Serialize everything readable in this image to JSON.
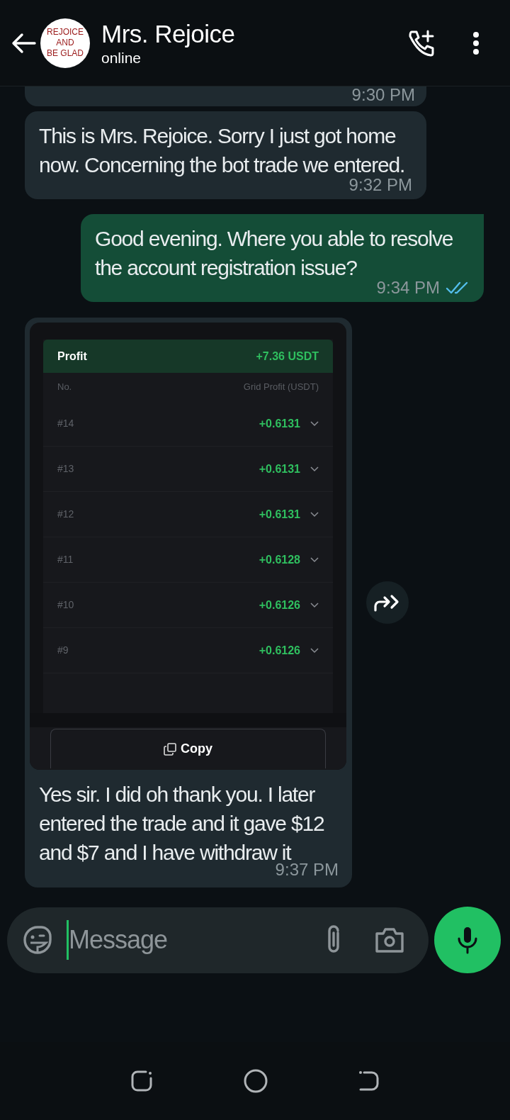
{
  "header": {
    "name": "Mrs. Rejoice",
    "status": "online",
    "avatar_lines": [
      "REJOICE",
      "AND",
      "BE GLAD"
    ]
  },
  "messages": [
    {
      "kind": "cut",
      "outgoing": false,
      "time": "9:30 PM"
    },
    {
      "kind": "text",
      "outgoing": false,
      "text": "This is Mrs. Rejoice. Sorry I just got home now. Concerning the bot trade we entered.",
      "time": "9:32 PM"
    },
    {
      "kind": "text",
      "outgoing": true,
      "text": "Good evening. Where you able to resolve the account registration issue?",
      "time": "9:34 PM",
      "read": true
    },
    {
      "kind": "image",
      "outgoing": false,
      "screenshot": {
        "title": "Profit",
        "total": "+7.36 USDT",
        "columns": [
          "No.",
          "Grid Profit (USDT)"
        ],
        "rows": [
          {
            "no": "#14",
            "value": "+0.6131"
          },
          {
            "no": "#13",
            "value": "+0.6131"
          },
          {
            "no": "#12",
            "value": "+0.6131"
          },
          {
            "no": "#11",
            "value": "+0.6128"
          },
          {
            "no": "#10",
            "value": "+0.6126"
          },
          {
            "no": "#9",
            "value": "+0.6126"
          }
        ],
        "copy_label": "Copy"
      },
      "text": "Yes sir. I did oh thank you. I later entered the trade and it gave $12 and $7 and I have withdraw it",
      "time": "9:37 PM"
    }
  ],
  "composer": {
    "placeholder": "Message"
  }
}
